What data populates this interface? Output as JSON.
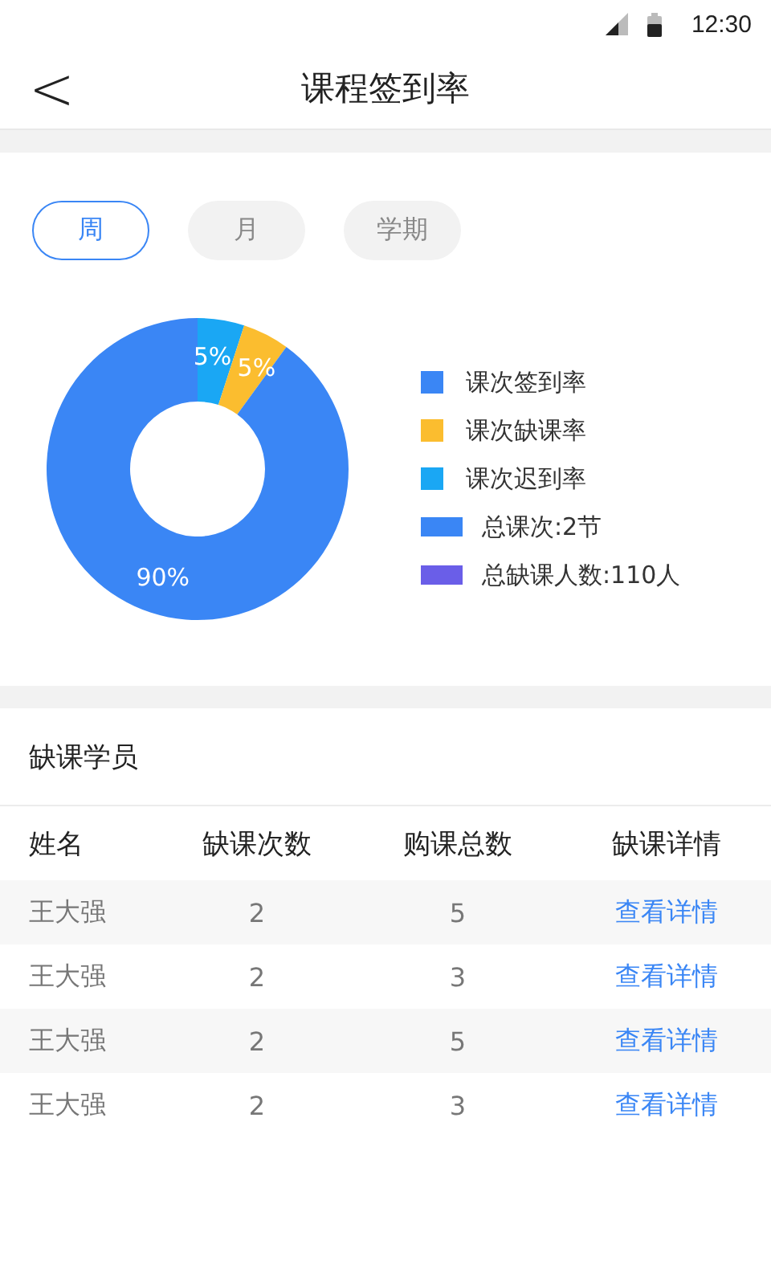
{
  "status_bar": {
    "time": "12:30"
  },
  "header": {
    "back_icon": "<",
    "title": "课程签到率"
  },
  "tabs": [
    {
      "label": "周",
      "selected": true
    },
    {
      "label": "月",
      "selected": false
    },
    {
      "label": "学期",
      "selected": false
    }
  ],
  "chart": {
    "chart_data": {
      "type": "donut",
      "categories": [
        "课次迟到率",
        "课次缺课率",
        "课次签到率"
      ],
      "values": [
        5,
        5,
        90
      ],
      "colors": [
        "#1aa7f4",
        "#fbbd2f",
        "#3a86f5"
      ],
      "value_labels": [
        "5%",
        "5%",
        "90%"
      ],
      "legend": "right"
    },
    "totals": [
      {
        "label": "总课次:2节",
        "color": "#3a86f5"
      },
      {
        "label": "总缺课人数:110人",
        "color": "#6a5ee8"
      }
    ]
  },
  "absent_section": {
    "title": "缺课学员",
    "columns": [
      "姓名",
      "缺课次数",
      "购课总数",
      "缺课详情"
    ],
    "rows": [
      {
        "name": "王大强",
        "absences": "2",
        "purchased": "5",
        "link": "查看详情"
      },
      {
        "name": "王大强",
        "absences": "2",
        "purchased": "3",
        "link": "查看详情"
      },
      {
        "name": "王大强",
        "absences": "2",
        "purchased": "5",
        "link": "查看详情"
      },
      {
        "name": "王大强",
        "absences": "2",
        "purchased": "3",
        "link": "查看详情"
      }
    ]
  }
}
